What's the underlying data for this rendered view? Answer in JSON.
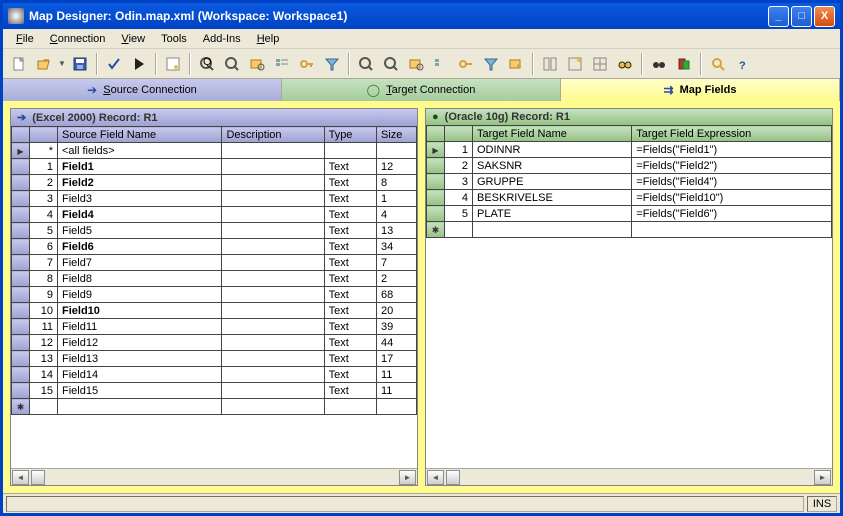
{
  "window": {
    "title": "Map Designer: Odin.map.xml (Workspace: Workspace1)"
  },
  "menu": {
    "file": "File",
    "connection": "Connection",
    "view": "View",
    "tools": "Tools",
    "addins": "Add-Ins",
    "help": "Help"
  },
  "tabs": {
    "source": "Source Connection",
    "target": "Target Connection",
    "map": "Map Fields"
  },
  "source_panel": {
    "title": "(Excel 2000) Record: R1",
    "headers": {
      "name": "Source Field Name",
      "desc": "Description",
      "type": "Type",
      "size": "Size"
    },
    "allfields": "<all fields>",
    "rows": [
      {
        "n": "1",
        "name": "Field1",
        "bold": true,
        "desc": "",
        "type": "Text",
        "size": "12"
      },
      {
        "n": "2",
        "name": "Field2",
        "bold": true,
        "desc": "",
        "type": "Text",
        "size": "8"
      },
      {
        "n": "3",
        "name": "Field3",
        "bold": false,
        "desc": "",
        "type": "Text",
        "size": "1"
      },
      {
        "n": "4",
        "name": "Field4",
        "bold": true,
        "desc": "",
        "type": "Text",
        "size": "4"
      },
      {
        "n": "5",
        "name": "Field5",
        "bold": false,
        "desc": "",
        "type": "Text",
        "size": "13"
      },
      {
        "n": "6",
        "name": "Field6",
        "bold": true,
        "desc": "",
        "type": "Text",
        "size": "34"
      },
      {
        "n": "7",
        "name": "Field7",
        "bold": false,
        "desc": "",
        "type": "Text",
        "size": "7"
      },
      {
        "n": "8",
        "name": "Field8",
        "bold": false,
        "desc": "",
        "type": "Text",
        "size": "2"
      },
      {
        "n": "9",
        "name": "Field9",
        "bold": false,
        "desc": "",
        "type": "Text",
        "size": "68"
      },
      {
        "n": "10",
        "name": "Field10",
        "bold": true,
        "desc": "",
        "type": "Text",
        "size": "20"
      },
      {
        "n": "11",
        "name": "Field11",
        "bold": false,
        "desc": "",
        "type": "Text",
        "size": "39"
      },
      {
        "n": "12",
        "name": "Field12",
        "bold": false,
        "desc": "",
        "type": "Text",
        "size": "44"
      },
      {
        "n": "13",
        "name": "Field13",
        "bold": false,
        "desc": "",
        "type": "Text",
        "size": "17"
      },
      {
        "n": "14",
        "name": "Field14",
        "bold": false,
        "desc": "",
        "type": "Text",
        "size": "11"
      },
      {
        "n": "15",
        "name": "Field15",
        "bold": false,
        "desc": "",
        "type": "Text",
        "size": "11"
      }
    ]
  },
  "target_panel": {
    "title": "(Oracle 10g) Record: R1",
    "headers": {
      "name": "Target Field Name",
      "expr": "Target Field Expression"
    },
    "rows": [
      {
        "n": "1",
        "name": "ODINNR",
        "expr": "=Fields(\"Field1\")"
      },
      {
        "n": "2",
        "name": "SAKSNR",
        "expr": "=Fields(\"Field2\")"
      },
      {
        "n": "3",
        "name": "GRUPPE",
        "expr": "=Fields(\"Field4\")"
      },
      {
        "n": "4",
        "name": "BESKRIVELSE",
        "expr": "=Fields(\"Field10\")"
      },
      {
        "n": "5",
        "name": "PLATE",
        "expr": "=Fields(\"Field6\")"
      }
    ]
  },
  "status": {
    "ins": "INS"
  }
}
